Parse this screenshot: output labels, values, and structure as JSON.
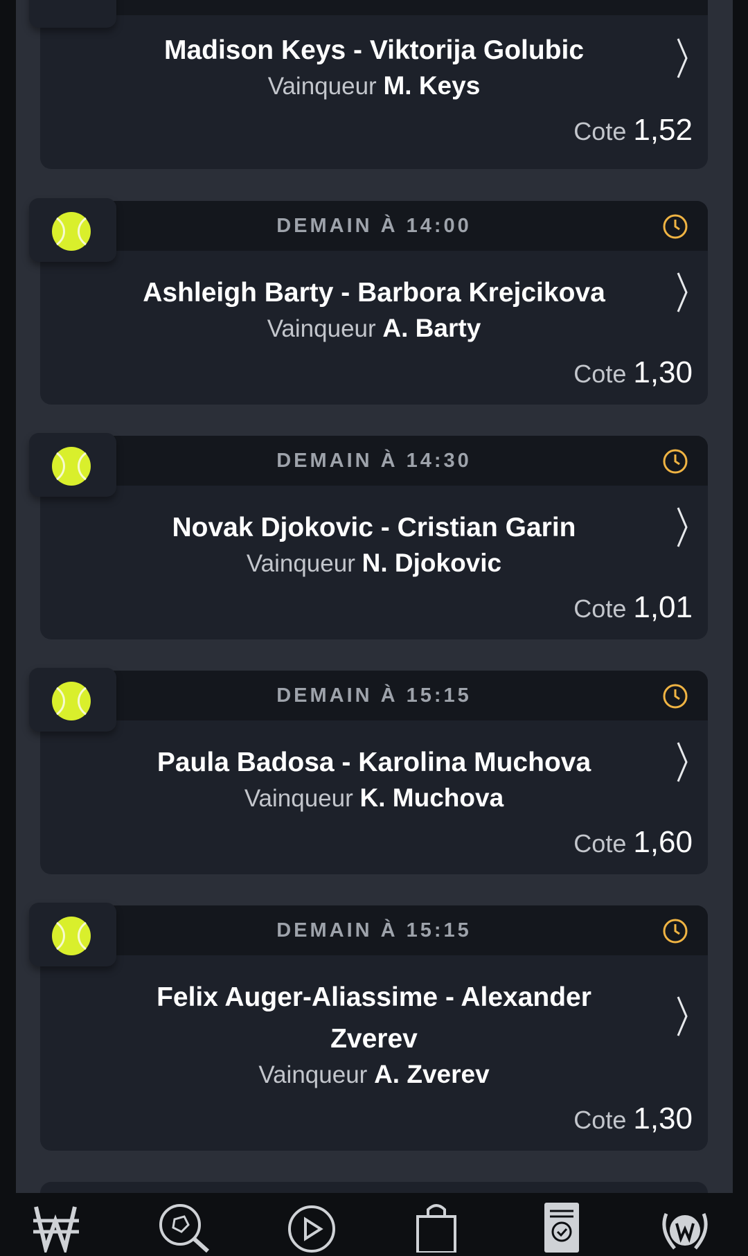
{
  "matches": [
    {
      "date": "",
      "title": "Madison Keys - Viktorija Golubic",
      "winner_label": "Vainqueur",
      "winner": "M. Keys",
      "odds_label": "Cote",
      "odds": "1,52"
    },
    {
      "date": "DEMAIN À 14:00",
      "title": "Ashleigh Barty - Barbora Krejcikova",
      "winner_label": "Vainqueur",
      "winner": "A. Barty",
      "odds_label": "Cote",
      "odds": "1,30"
    },
    {
      "date": "DEMAIN À 14:30",
      "title": "Novak Djokovic - Cristian Garin",
      "winner_label": "Vainqueur",
      "winner": "N. Djokovic",
      "odds_label": "Cote",
      "odds": "1,01"
    },
    {
      "date": "DEMAIN À 15:15",
      "title": "Paula Badosa - Karolina Muchova",
      "winner_label": "Vainqueur",
      "winner": "K. Muchova",
      "odds_label": "Cote",
      "odds": "1,60"
    },
    {
      "date": "DEMAIN À 15:15",
      "title": "Felix Auger-Aliassime - Alexander Zverev",
      "winner_label": "Vainqueur",
      "winner": "A. Zverev",
      "odds_label": "Cote",
      "odds": "1,30"
    }
  ],
  "colors": {
    "ball": "#d9ef2c",
    "clock": "#f0b443",
    "nav_icon": "#cfd2d6"
  },
  "nav": {
    "items": [
      {
        "icon": "winamax-logo-icon"
      },
      {
        "icon": "sports-search-icon"
      },
      {
        "icon": "live-play-icon"
      },
      {
        "icon": "shop-bag-icon"
      },
      {
        "icon": "bet-ticket-icon"
      },
      {
        "icon": "laurel-trophy-icon"
      }
    ]
  }
}
